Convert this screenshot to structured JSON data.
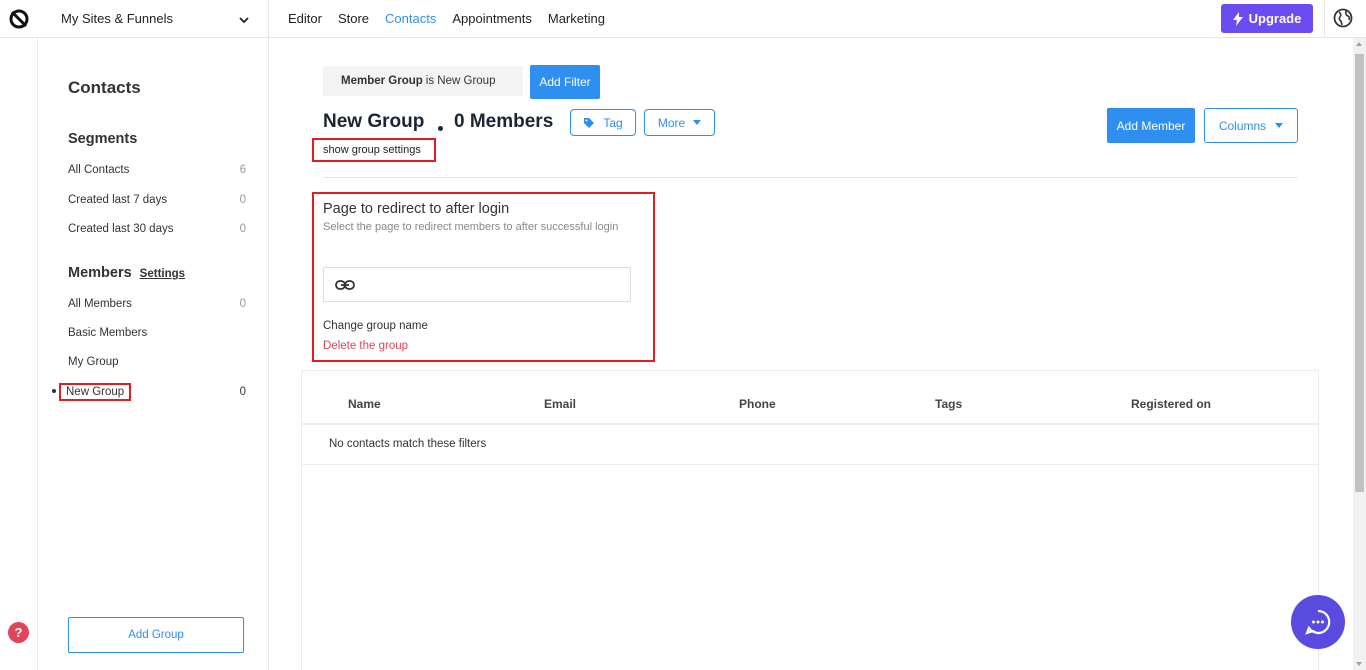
{
  "topbar": {
    "site_selector": "My Sites & Funnels",
    "nav": [
      {
        "label": "Editor",
        "active": false
      },
      {
        "label": "Store",
        "active": false
      },
      {
        "label": "Contacts",
        "active": true
      },
      {
        "label": "Appointments",
        "active": false
      },
      {
        "label": "Marketing",
        "active": false
      }
    ],
    "upgrade_label": "Upgrade",
    "icons": {
      "logo": "brand-logo-icon",
      "chevron": "chevron-down-icon",
      "upgrade": "bolt-icon",
      "globe": "globe-icon"
    },
    "accent_color": "#6a4cf1"
  },
  "sidebar": {
    "title": "Contacts",
    "segments_heading": "Segments",
    "segments": [
      {
        "label": "All Contacts",
        "count": "6"
      },
      {
        "label": "Created last 7 days",
        "count": "0"
      },
      {
        "label": "Created last 30 days",
        "count": "0"
      }
    ],
    "members_heading": "Members",
    "settings_link": "Settings",
    "groups": [
      {
        "label": "All Members",
        "count": "0"
      },
      {
        "label": "Basic Members",
        "count": ""
      },
      {
        "label": "My Group",
        "count": ""
      },
      {
        "label": "New Group",
        "count": "0",
        "selected": true
      }
    ],
    "add_group_label": "Add Group"
  },
  "main": {
    "filter": {
      "field": "Member Group",
      "operator_value": "is New Group"
    },
    "add_filter_label": "Add Filter",
    "group_name": "New Group",
    "member_count": "0 Members",
    "tag_label": "Tag",
    "more_label": "More",
    "add_member_label": "Add Member",
    "columns_label": "Columns",
    "show_settings_label": "show group settings",
    "settings": {
      "redirect_title": "Page to redirect to after login",
      "redirect_desc": "Select the page to redirect members to after successful login",
      "link_value": "",
      "change_name_label": "Change group name",
      "delete_label": "Delete the group"
    },
    "table": {
      "columns": [
        "Name",
        "Email",
        "Phone",
        "Tags",
        "Registered on"
      ],
      "empty_message": "No contacts match these filters"
    },
    "primary_color": "#2f8ff0",
    "danger_color": "#e0455a",
    "highlight_color": "#e31b23"
  },
  "help_label": "?"
}
